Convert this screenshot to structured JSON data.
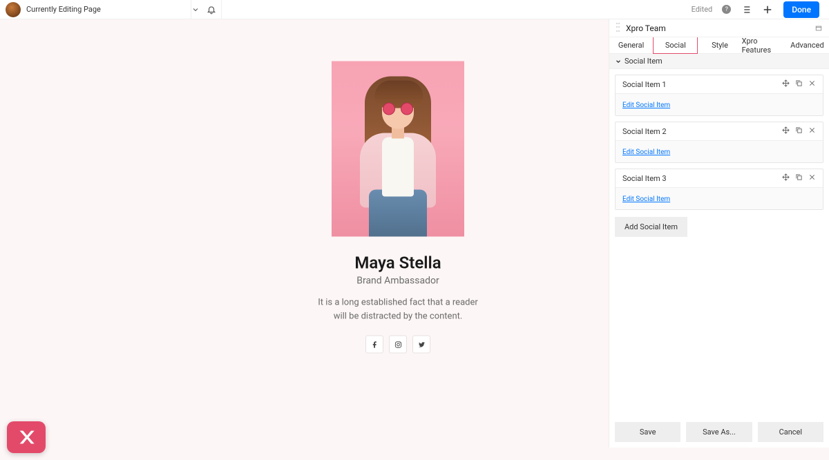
{
  "topbar": {
    "title": "Currently Editing Page",
    "edited": "Edited",
    "done": "Done"
  },
  "team": {
    "name": "Maya Stella",
    "role": "Brand Ambassador",
    "desc": "It is a long established fact that a reader will be distracted by the content."
  },
  "panel": {
    "title": "Xpro Team",
    "tabs": [
      "General",
      "Social",
      "Style",
      "Xpro Features",
      "Advanced"
    ],
    "section": "Social Item",
    "items": [
      {
        "label": "Social Item 1",
        "edit": "Edit Social Item"
      },
      {
        "label": "Social Item 2",
        "edit": "Edit Social Item"
      },
      {
        "label": "Social Item 3",
        "edit": "Edit Social Item"
      }
    ],
    "add": "Add Social Item",
    "footer": {
      "save": "Save",
      "saveas": "Save As...",
      "cancel": "Cancel"
    }
  }
}
